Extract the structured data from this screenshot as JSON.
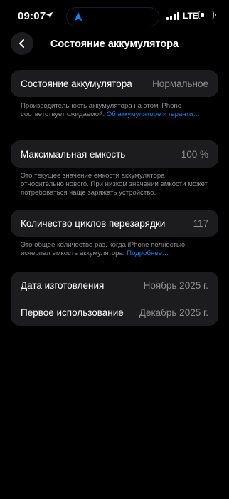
{
  "status_bar": {
    "time": "09:07",
    "network": "LTE",
    "battery_level_percent": 20,
    "icons": [
      "location-arrow-icon",
      "navigation-icon",
      "signal-icon",
      "battery-icon"
    ]
  },
  "nav": {
    "title": "Состояние аккумулятора",
    "back_icon": "chevron-left-icon"
  },
  "health": {
    "label": "Состояние аккумулятора",
    "value": "Нормальное",
    "note": "Производительность аккумулятора на этом iPhone соответствует ожидаемой. ",
    "note_link": "Об аккумуляторе и гаранти…"
  },
  "capacity": {
    "label": "Максимальная емкость",
    "value": "100 %",
    "note": "Это текущее значение емкости аккумулятора относительно нового. При низком значении емкости может потребоваться чаще заряжать устройство."
  },
  "cycles": {
    "label": "Количество циклов перезарядки",
    "value": "117",
    "note": "Это общее количество раз, когда iPhone полностью исчерпал емкость аккумулятора. ",
    "note_link": "Подробнее…"
  },
  "dates": {
    "manufacture_label": "Дата изготовления",
    "manufacture_value": "Ноябрь 2025 г.",
    "first_use_label": "Первое использование",
    "first_use_value": "Декабрь 2025 г."
  },
  "colors": {
    "background": "#000000",
    "card": "#1c1c1e",
    "secondary_text": "#8e8e93",
    "link": "#0a84ff"
  }
}
